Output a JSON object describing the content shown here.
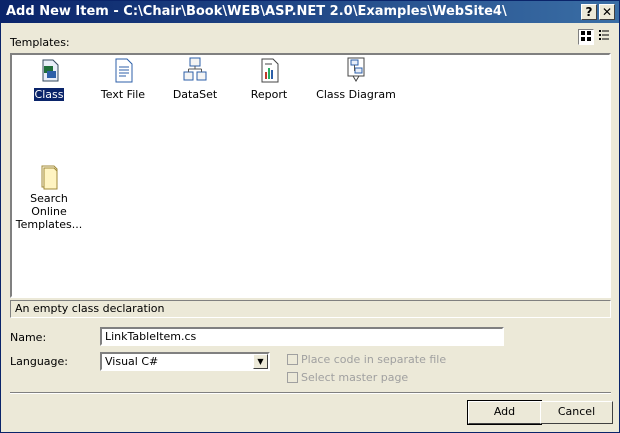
{
  "window": {
    "title": "Add New Item - C:\\Chair\\Book\\WEB\\ASP.NET 2.0\\Examples\\WebSite4\\",
    "help_glyph": "?",
    "close_glyph": "✕"
  },
  "templates": {
    "label": "Templates:",
    "items": [
      {
        "label": "Class",
        "icon": "class-icon",
        "selected": true
      },
      {
        "label": "Text File",
        "icon": "text-file-icon",
        "selected": false
      },
      {
        "label": "DataSet",
        "icon": "dataset-icon",
        "selected": false
      },
      {
        "label": "Report",
        "icon": "report-icon",
        "selected": false
      },
      {
        "label": "Class Diagram",
        "icon": "class-diagram-icon",
        "selected": false
      },
      {
        "label": "Search Online Templates...",
        "icon": "search-online-icon",
        "selected": false
      }
    ]
  },
  "description": "An empty class declaration",
  "form": {
    "name_label": "Name:",
    "name_value": "LinkTableItem.cs",
    "language_label": "Language:",
    "language_value": "Visual C#",
    "option_separate_file": "Place code in separate file",
    "option_master_page": "Select master page"
  },
  "buttons": {
    "add": "Add",
    "cancel": "Cancel"
  },
  "colors": {
    "title_bar_start": "#0a246a",
    "title_bar_end": "#3a6ea5",
    "face": "#ece9d8",
    "selection": "#0a246a"
  }
}
